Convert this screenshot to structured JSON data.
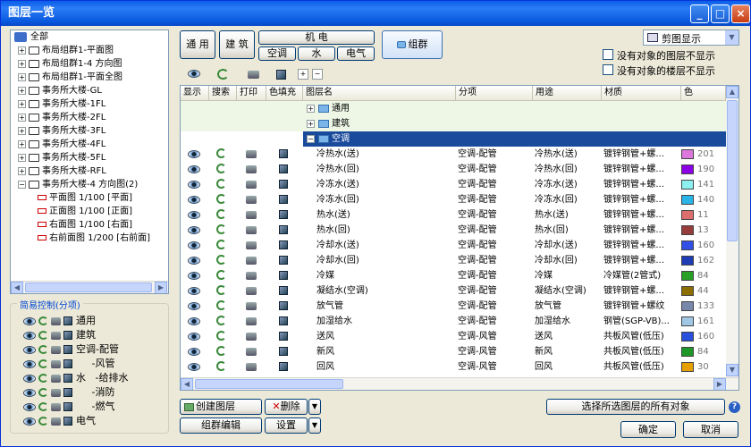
{
  "window": {
    "title": "图层一览"
  },
  "tree": {
    "items": [
      {
        "label": "全部",
        "depth": 0,
        "toggle": "",
        "kind": "root"
      },
      {
        "label": "布局组群1-平面图",
        "depth": 1,
        "toggle": "+",
        "kind": "folder"
      },
      {
        "label": "布局组群1-4 方向图",
        "depth": 1,
        "toggle": "+",
        "kind": "folder"
      },
      {
        "label": "布局组群1-平面全图",
        "depth": 1,
        "toggle": "+",
        "kind": "folder"
      },
      {
        "label": "事务所大楼-GL",
        "depth": 1,
        "toggle": "+",
        "kind": "folder"
      },
      {
        "label": "事务所大楼-1FL",
        "depth": 1,
        "toggle": "+",
        "kind": "folder"
      },
      {
        "label": "事务所大楼-2FL",
        "depth": 1,
        "toggle": "+",
        "kind": "folder"
      },
      {
        "label": "事务所大楼-3FL",
        "depth": 1,
        "toggle": "+",
        "kind": "folder"
      },
      {
        "label": "事务所大楼-4FL",
        "depth": 1,
        "toggle": "+",
        "kind": "folder"
      },
      {
        "label": "事务所大楼-5FL",
        "depth": 1,
        "toggle": "+",
        "kind": "folder"
      },
      {
        "label": "事务所大楼-RFL",
        "depth": 1,
        "toggle": "+",
        "kind": "folder"
      },
      {
        "label": "事务所大楼-4 方向图(2)",
        "depth": 1,
        "toggle": "-",
        "kind": "folder"
      },
      {
        "label": "平面图 1/100 [平面]",
        "depth": 2,
        "toggle": "",
        "kind": "leaf"
      },
      {
        "label": "正面图 1/100 [正面]",
        "depth": 2,
        "toggle": "",
        "kind": "leaf"
      },
      {
        "label": "右面图 1/100 [右面]",
        "depth": 2,
        "toggle": "",
        "kind": "leaf"
      },
      {
        "label": "右前面图 1/200 [右前面]",
        "depth": 2,
        "toggle": "",
        "kind": "leaf"
      }
    ]
  },
  "simple_control": {
    "title": "简易控制(分项)",
    "rows": [
      {
        "label": "通用"
      },
      {
        "label": "建筑"
      },
      {
        "label": "空调-配管"
      },
      {
        "label": "     -风管"
      },
      {
        "label": "水   -给排水"
      },
      {
        "label": "     -消防"
      },
      {
        "label": "     -燃气"
      },
      {
        "label": "电气"
      }
    ]
  },
  "category_buttons": {
    "general": "通 用",
    "building": "建 筑",
    "mech_elec": "机 电",
    "hvac": "空调",
    "water": "水",
    "electric": "电气",
    "group": "组群"
  },
  "clip_display": {
    "value": "剪图显示"
  },
  "options": {
    "hide_empty_layers": "没有对象的图层不显示",
    "hide_empty_floors": "没有对象的楼层不显示"
  },
  "table": {
    "headers": [
      "显示",
      "搜索",
      "打印",
      "色填充",
      "图层名",
      "分项",
      "用途",
      "材质",
      "色"
    ],
    "groups": [
      {
        "label": "通用",
        "toggle": "+"
      },
      {
        "label": "建筑",
        "toggle": "+"
      },
      {
        "label": "空调",
        "toggle": "-"
      }
    ],
    "rows": [
      {
        "name": "冷热水(送)",
        "category": "空调-配管",
        "usage": "冷热水(送)",
        "material": "镀锌钢管+螺...",
        "color": "#dc78dc",
        "color_num": "201"
      },
      {
        "name": "冷热水(回)",
        "category": "空调-配管",
        "usage": "冷热水(回)",
        "material": "镀锌钢管+螺...",
        "color": "#8c00e6",
        "color_num": "190"
      },
      {
        "name": "冷冻水(送)",
        "category": "空调-配管",
        "usage": "冷冻水(送)",
        "material": "镀锌钢管+螺...",
        "color": "#8cf0f0",
        "color_num": "141"
      },
      {
        "name": "冷冻水(回)",
        "category": "空调-配管",
        "usage": "冷冻水(回)",
        "material": "镀锌钢管+螺...",
        "color": "#28b4e6",
        "color_num": "140"
      },
      {
        "name": "热水(送)",
        "category": "空调-配管",
        "usage": "热水(送)",
        "material": "镀锌钢管+螺...",
        "color": "#dc6e6e",
        "color_num": "11"
      },
      {
        "name": "热水(回)",
        "category": "空调-配管",
        "usage": "热水(回)",
        "material": "镀锌钢管+螺...",
        "color": "#963c3c",
        "color_num": "13"
      },
      {
        "name": "冷却水(送)",
        "category": "空调-配管",
        "usage": "冷却水(送)",
        "material": "镀锌钢管+螺...",
        "color": "#3250e6",
        "color_num": "160"
      },
      {
        "name": "冷却水(回)",
        "category": "空调-配管",
        "usage": "冷却水(回)",
        "material": "镀锌钢管+螺...",
        "color": "#1e3cb4",
        "color_num": "162"
      },
      {
        "name": "冷媒",
        "category": "空调-配管",
        "usage": "冷媒",
        "material": "冷媒管(2管式)",
        "color": "#28a028",
        "color_num": "84"
      },
      {
        "name": "凝结水(空调)",
        "category": "空调-配管",
        "usage": "凝结水(空调)",
        "material": "镀锌钢管+螺...",
        "color": "#8c6e00",
        "color_num": "44"
      },
      {
        "name": "放气管",
        "category": "空调-配管",
        "usage": "放气管",
        "material": "镀锌钢管+螺纹",
        "color": "#7888aa",
        "color_num": "133"
      },
      {
        "name": "加湿给水",
        "category": "空调-配管",
        "usage": "加湿给水",
        "material": "钢管(SGP-VB)...",
        "color": "#a0c8e6",
        "color_num": "161"
      },
      {
        "name": "送风",
        "category": "空调-风管",
        "usage": "送风",
        "material": "共板风管(低压)",
        "color": "#2850dc",
        "color_num": "160"
      },
      {
        "name": "新风",
        "category": "空调-风管",
        "usage": "新风",
        "material": "共板风管(低压)",
        "color": "#1e9628",
        "color_num": "84"
      },
      {
        "name": "回风",
        "category": "空调-风管",
        "usage": "回风",
        "material": "共板风管(低压)",
        "color": "#e6a000",
        "color_num": "30"
      }
    ]
  },
  "bottom": {
    "create_layer": "创建图层",
    "delete": "删除",
    "group_edit": "组群编辑",
    "settings": "设置",
    "select_all_objects": "选择所选图层的所有对象",
    "ok": "确定",
    "cancel": "取消",
    "help": "?"
  }
}
